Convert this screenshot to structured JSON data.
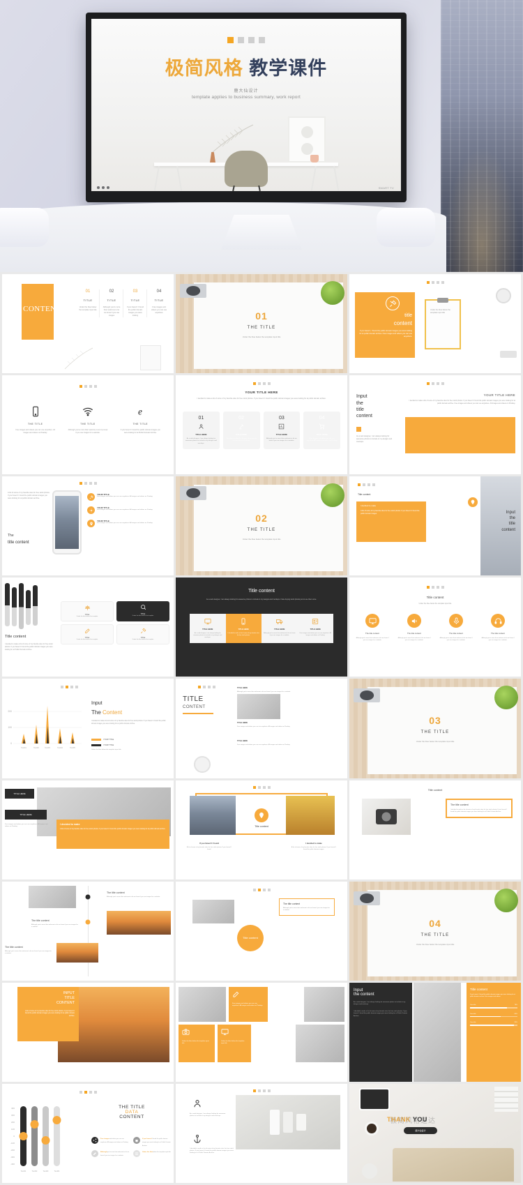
{
  "hero": {
    "square_markers": [
      "on",
      "off",
      "off",
      "off"
    ],
    "title_orange": "极简风格",
    "title_dark": "教学课件",
    "subtitle_cn": "鹿大仙设计",
    "subtitle_en": "template applies to business summary, work report",
    "tv_brand_label": "SMART TV"
  },
  "accent_colors": {
    "orange": "#f7aa3c",
    "orange_text": "#eda63a",
    "dark": "#2b2b2b",
    "navy": "#33405c",
    "grey_bg": "#e9e9e9"
  },
  "slides": [
    {
      "id": "contents",
      "type": "contents",
      "panel_title": "CONTENTS",
      "columns": [
        {
          "num": "01",
          "title": "TITLE",
          "body": "Under the blue below the template input title"
        },
        {
          "num": "02",
          "title": "TITLE",
          "body": "Although you're more than welcome to let me know if you use images"
        },
        {
          "num": "03",
          "title": "TITLE",
          "body": "If you haven't I found the public domain images you were looking"
        },
        {
          "num": "04",
          "title": "TITLE",
          "body": "Free images and videos you can use anywhere"
        }
      ]
    },
    {
      "id": "section-01",
      "type": "section",
      "number": "01",
      "title": "THE TITLE",
      "sub": "Under the blue below the template input title"
    },
    {
      "id": "title-content-clipboard",
      "type": "orange-panel-photo",
      "title_line1": "title",
      "title_line2": "content",
      "body": "If you haven't, I found the public domain images you were looking for at public domain archive. Free images and videos you can use anywhere.",
      "card_text": "Under the blue below the template input title",
      "icon": "tools-icon"
    },
    {
      "id": "three-icons",
      "type": "icon-row-3",
      "items": [
        {
          "icon": "smartphone-icon",
          "label": "THE TITLE",
          "body": "Free images and videos you can use anywhere. All images and videos on Pixabay."
        },
        {
          "icon": "wifi-icon",
          "label": "THE TITLE",
          "body": "Although you're more than welcome to let me know if you use images for a website."
        },
        {
          "icon": "browser-icon",
          "label": "THE TITLE",
          "body": "If you haven't I found the public domain images you were looking for at Public Domain Archive."
        }
      ]
    },
    {
      "id": "your-title-here-cards",
      "type": "numbered-cards-4",
      "title": "YOUR TITLE HERE",
      "sub": "I decided to make a list of some of my favorite sites for free stock photos. If you haven't I found the public domain images you were looking for at public domain archive.",
      "cards": [
        {
          "num": "01",
          "label": "TITLE HERE",
          "body": "As a web designer, I am always looking for awesome photos to include in my designs and mockups.",
          "filled": false,
          "icon": "user-icon"
        },
        {
          "num": "02",
          "label": "TITLE HERE",
          "body": "I decided to make a list of some of my favorite sites for free stock photos.",
          "filled": true,
          "icon": "gavel-icon"
        },
        {
          "num": "03",
          "label": "TITLE HERE",
          "body": "Although you're more than welcome to let me know if you use images for a website.",
          "filled": false,
          "icon": "chart-icon"
        },
        {
          "num": "04",
          "label": "TITLE HERE",
          "body": "Free images and videos you can use anywhere. All images and videos on Pixabay.",
          "filled": true,
          "icon": "cart-icon"
        }
      ]
    },
    {
      "id": "input-title-content-left",
      "type": "split-left-title",
      "title_lines": [
        "Input",
        "the",
        "title",
        "content"
      ],
      "body": "As a web designer, I am always looking for awesome photos to include in my designs and mockups.",
      "right_title": "YOUR TITLE HERE",
      "right_body": "I decided to make a list of some of my favorite sites for free stock photos. If you haven't I found the public domain images you were looking for at public domain archive. Free images and videos you can use anywhere. All images and videos on Pixabay."
    },
    {
      "id": "phone-mockup",
      "type": "phone-mockup",
      "title_line1": "The",
      "title_line2": "title content",
      "body": "A list of some of my favorite sites for free stock photos. If you haven't I found the public domain images you were looking for at public domain archive.",
      "items": [
        {
          "label": "YOUR TITLE",
          "body": "Free images and videos you can use anywhere. All images and videos on Pixabay.",
          "icon": "tools-icon"
        },
        {
          "label": "YOUR TITLE",
          "body": "Free images and videos you can use anywhere. All images and videos on Pixabay.",
          "icon": "gear-icon"
        },
        {
          "label": "YOUR TITLE",
          "body": "Free images and videos you can use anywhere. All images and videos on Pixabay.",
          "icon": "pin-icon"
        }
      ]
    },
    {
      "id": "section-02",
      "type": "section",
      "number": "02",
      "title": "THE TITLE",
      "sub": "Under the blue below the template input title"
    },
    {
      "id": "input-the-title-content-right",
      "type": "split-right-title",
      "left_title": "Title content",
      "left_body": "A list of some of my favorite sites for free stock photos. If you haven't I found the public domain images.",
      "left_note": "I decided to make",
      "title_lines": [
        "Input",
        "the",
        "title",
        "content"
      ],
      "icon": "pin-icon"
    },
    {
      "id": "brushes-title-content",
      "type": "brushes",
      "title_line1": "Title content",
      "body": "I decided to make a list of some of my favorite sites for free stock photos. If you haven't I found the public domain images you were looking for at Public Domain Archive.",
      "cards": [
        {
          "label": "TITLE",
          "body": "Under the blue below the template",
          "icon": "scale-icon"
        },
        {
          "label": "TITLE",
          "body": "Under the blue below the template",
          "icon": "search-icon"
        },
        {
          "label": "TITLE",
          "body": "Under the blue below the template",
          "icon": "edit-icon"
        },
        {
          "label": "TITLE",
          "body": "Under the blue below the template",
          "icon": "tools-icon"
        }
      ]
    },
    {
      "id": "dark-title-content",
      "type": "dark-cards-4",
      "title": "Title content",
      "sub": "As a web designer, I am always looking for awesome photos to include in my designs and mockups. I hate buying stock photos just to use them once.",
      "cards": [
        {
          "label": "TITLE HERE",
          "body": "As a web designer, I am always looking for awesome photos to include in my designs and mockups.",
          "filled": false,
          "icon": "monitor-icon"
        },
        {
          "label": "TITLE HERE",
          "body": "I decided to make a list of some of my favorite sites for free stock photos.",
          "filled": true,
          "icon": "smartphone-icon"
        },
        {
          "label": "TITLE HERE",
          "body": "Although you're more than welcome to let me know if you use images for a website.",
          "filled": false,
          "icon": "truck-icon"
        },
        {
          "label": "TITLE HERE",
          "body": "Free images and videos you can use anywhere. All images and videos on Pixabay.",
          "filled": false,
          "icon": "id-icon"
        }
      ]
    },
    {
      "id": "circle-icons-4",
      "type": "circle-icons-4",
      "title": "Title content",
      "sub": "Under the blue below the template input title",
      "items": [
        {
          "icon": "monitor-icon",
          "label": "The title content",
          "body": "Although you're more than welcome to let me know if you use images for a website."
        },
        {
          "icon": "speaker-icon",
          "label": "The title content",
          "body": "Although you're more than welcome to let me know if you use images for a website."
        },
        {
          "icon": "microphone-icon",
          "label": "The title content",
          "body": "Although you're more than welcome to let me know if you use images for a website."
        },
        {
          "icon": "headphones-icon",
          "label": "The title content",
          "body": "Although you're more than welcome to let me know if you use images for a website."
        }
      ]
    },
    {
      "id": "chart-input-the-content",
      "type": "chart",
      "title_line1": "Input",
      "title_line2_plain": "The ",
      "title_line2_accent": "Content",
      "body": "I decided to make a list of some of my favorite sites for free stock photos. If you haven't I found the public domain images you were looking for at public domain archive.",
      "legend": [
        {
          "label": "YOUR TITLE",
          "color": "#f7aa3c"
        },
        {
          "label": "YOUR TITLE",
          "color": "#2b2b2b"
        }
      ],
      "legend_note": "Under the blue below the template input title"
    },
    {
      "id": "title-content-coffee",
      "type": "title-content-photos",
      "title_line1": "TITLE",
      "title_line2": "CONTENT",
      "rows": [
        {
          "label": "TITLE HERE",
          "body": "Although you're more than welcome to let me know if you use images for a website."
        },
        {
          "label": "TITLE HERE",
          "body": "Free images and videos you can use anywhere. All images and videos on Pixabay."
        },
        {
          "label": "TITLE HERE",
          "body": "Free images and videos you can use anywhere. All images and videos on Pixabay."
        }
      ]
    },
    {
      "id": "section-03",
      "type": "section",
      "number": "03",
      "title": "THE TITLE",
      "sub": "Under the blue below the template input title"
    },
    {
      "id": "laptop-title-here",
      "type": "laptop-panel",
      "tag": "TITLE HERE",
      "sub_tag": "TITLE HERE",
      "panel_title": "I decided to make",
      "panel_body": "A list of some of my favorite sites for free stock photos. If you haven't I found the public domain images you were looking for at public domain archive.",
      "foot": "Free images and videos you can use anywhere. All images and videos on Pixabay."
    },
    {
      "id": "taxi-frame",
      "type": "frame-photo",
      "badge": "Title content",
      "left_label": "If you haven't I found",
      "left_body": "A list of some of my favorite sites for free stock photos. If you haven't I found.",
      "right_label": "I decided to make",
      "right_body": "A list of some of my favorite sites for free stock photos. If you haven't I found the public domain images.",
      "icon": "pin-icon"
    },
    {
      "id": "camera-title-content",
      "type": "photo-left-box-right",
      "title": "Title content",
      "box_title": "The title content",
      "box_body": "I decided to make a list of some of my favorite sites for free stock photos. If you haven't I found the public domain images you were looking for at Public Domain Archive."
    },
    {
      "id": "timeline-photos",
      "type": "timeline",
      "items": [
        {
          "label": "The title content",
          "body": "Although you're more than welcome to let me know if you use images for a website."
        },
        {
          "label": "The title content",
          "body": "Although you're more than welcome to let me know if you use images for a website."
        },
        {
          "label": "The title content",
          "body": "Although you're more than welcome to let me know if you use images for a website."
        }
      ]
    },
    {
      "id": "circle-title-content",
      "type": "circle-badge",
      "badge": "Title content",
      "box_title": "The title content",
      "box_body": "Although you're more than welcome to let me know if you use images for a website."
    },
    {
      "id": "section-04",
      "type": "section",
      "number": "04",
      "title": "THE TITLE",
      "sub": "Under the blue below the template input title"
    },
    {
      "id": "bridge-input-title",
      "type": "photo-panel",
      "title_lines": [
        "INPUT",
        "TITLE",
        "CONTENT"
      ],
      "body": "A list of some of my favorite sites for free stock photos. If you haven't I found the public domain images you were looking for at public domain archive."
    },
    {
      "id": "mosaic-tiles",
      "type": "mosaic",
      "tiles": [
        {
          "label": "Free images and videos you can use anywhere. All images and videos on Pixabay.",
          "icon": "edit-icon"
        },
        {
          "label": "Under the blue below the template input title",
          "icon": "camera-icon"
        },
        {
          "label": "Under the blue below the template input title",
          "icon": "monitor-icon"
        }
      ]
    },
    {
      "id": "dark-input-the-content",
      "type": "dark-split-bars",
      "title_line1": "Input",
      "title_line2": "the content",
      "body1": "As a web designer, I am always looking for awesome photos to include in my designs and mockups.",
      "body2": "I decided to make a list of some of my favorite sites for free stock photos. If you haven't I found the public domain images you were looking for at Public Domain Archive.",
      "panel_title": "Title content",
      "panel_sub": "If you haven't I found the public domain images you were looking for at public domain archive. Free images and videos.",
      "bars": [
        {
          "label": "Your title",
          "value": "78%"
        },
        {
          "label": "Your title",
          "value": "65%"
        },
        {
          "label": "Your title",
          "value": "92%"
        }
      ]
    },
    {
      "id": "slider-data-content",
      "type": "slider-chart",
      "title_line1": "THE TITLE",
      "title_accent": "DATA",
      "title_line3": "CONTENT",
      "legend": [
        {
          "label": "Free images",
          "body": "and videos you can use anywhere. All images and videos on Pixabay.",
          "icon": "share-icon"
        },
        {
          "label": "If you haven't",
          "body": "I found the public domain images you were looking for at Public Domain Archive.",
          "icon": "bag-icon"
        },
        {
          "label": "Although",
          "body": "you're more than welcome to let me know if you use images for a website.",
          "icon": "pen-icon"
        },
        {
          "label": "Under the blue",
          "body": "below the template input title.",
          "icon": "list-icon"
        }
      ]
    },
    {
      "id": "skincare-product",
      "type": "product-photo",
      "title": "As a web designer, I am always looking for awesome photos to include in my designs and mockups.",
      "body": "I decided to make a list of some of my favorite sites for free stock photos. If you haven't I found the public domain images you were looking for at Public Domain Archive."
    },
    {
      "id": "thank-you",
      "type": "thank-you",
      "thanks_orange": "THANK",
      "thanks_dark": " YOU",
      "badge": "鹿大仙设计",
      "watermark": "极简风格速达"
    }
  ],
  "chart_data": {
    "type": "bar",
    "title": "Input The Content",
    "categories": [
      "Text01",
      "Text02",
      "Text03",
      "Text04",
      "Text05"
    ],
    "series": [
      {
        "name": "YOUR TITLE",
        "color": "#f7aa3c",
        "values": [
          60,
          120,
          235,
          95,
          70
        ]
      },
      {
        "name": "YOUR TITLE",
        "color": "#2b2b2b",
        "values": [
          30,
          60,
          110,
          45,
          35
        ]
      }
    ],
    "ylabel": "",
    "xlabel": "",
    "ylim": [
      0,
      250
    ],
    "yticks": [
      0,
      100,
      200
    ],
    "grid": true,
    "legend_position": "bottom-right"
  },
  "slider_chart_data": {
    "type": "bar",
    "title": "THE TITLE DATA CONTENT",
    "categories": [
      "Text01",
      "Text02",
      "Text03",
      "Text04"
    ],
    "values": [
      0,
      -170,
      55,
      -220
    ],
    "handle_color": "#f7aa3c",
    "track_colors": [
      "#2b2b2b",
      "#8c8c8c",
      "#c9c9c9",
      "#dedede"
    ],
    "ylim": [
      -400,
      400
    ],
    "yticks": [
      -400,
      -300,
      -200,
      -100,
      0,
      100,
      200,
      300,
      400
    ],
    "grid": false
  }
}
